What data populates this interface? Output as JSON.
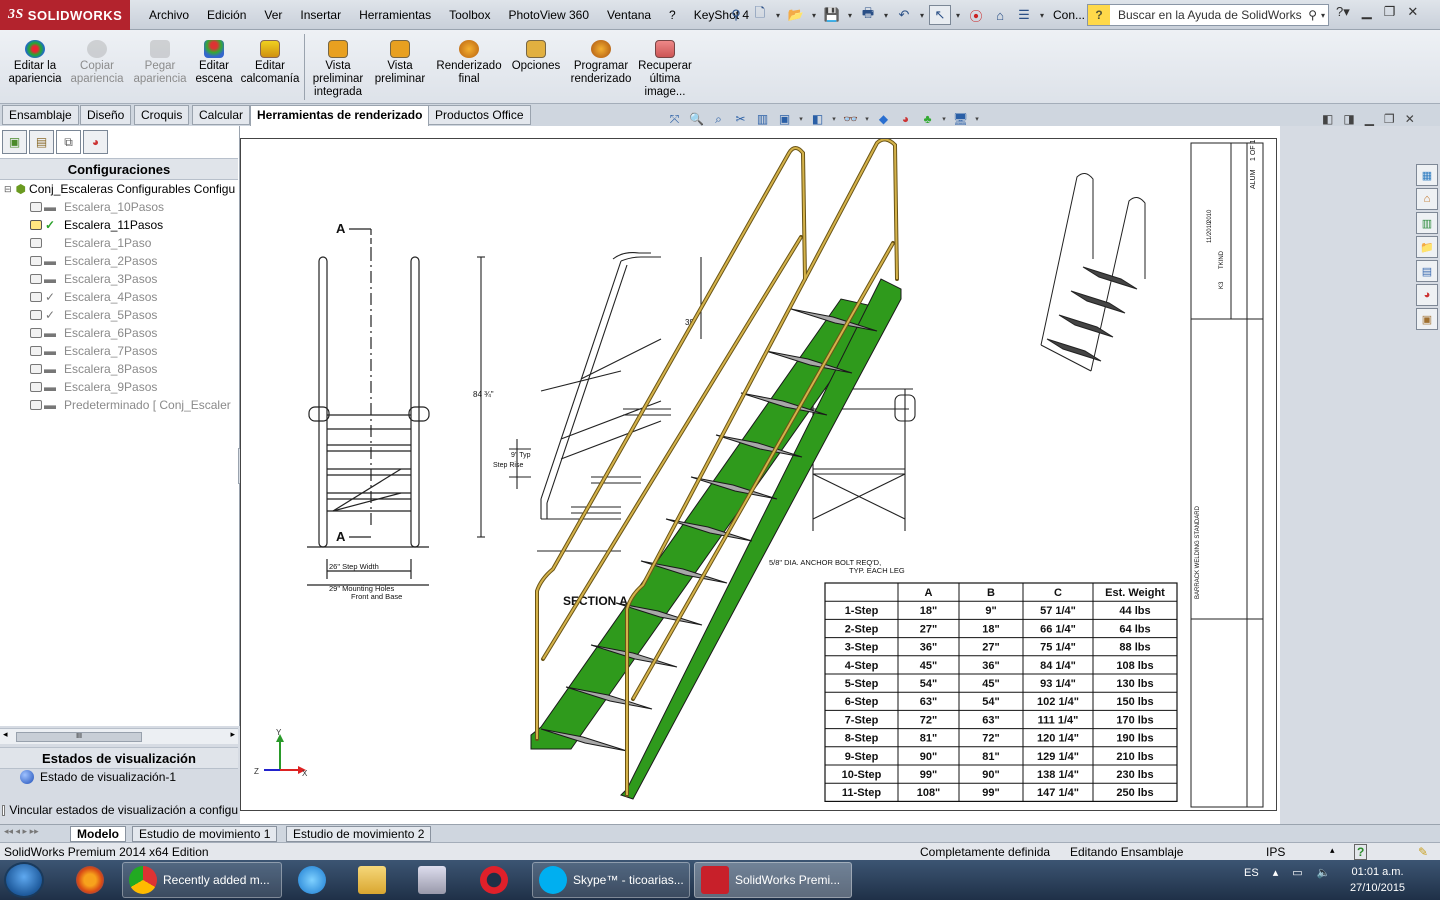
{
  "app": {
    "name": "SOLIDWORKS",
    "edition": "SolidWorks Premium 2014 x64 Edition"
  },
  "menu": [
    "Archivo",
    "Edición",
    "Ver",
    "Insertar",
    "Herramientas",
    "Toolbox",
    "PhotoView 360",
    "Ventana",
    "?",
    "KeyShot 4"
  ],
  "quick_overflow": "Con...",
  "search": {
    "placeholder": "Buscar en la Ayuda de SolidWorks"
  },
  "command_buttons": [
    {
      "label": "Editar la apariencia",
      "enabled": true
    },
    {
      "label": "Copiar apariencia",
      "enabled": false
    },
    {
      "label": "Pegar apariencia",
      "enabled": false
    },
    {
      "label": "Editar escena",
      "enabled": true
    },
    {
      "label": "Editar calcomanía",
      "enabled": true
    },
    {
      "label": "Vista preliminar integrada",
      "enabled": true
    },
    {
      "label": "Vista preliminar",
      "enabled": true
    },
    {
      "label": "Renderizado final",
      "enabled": true
    },
    {
      "label": "Opciones",
      "enabled": true
    },
    {
      "label": "Programar renderizado",
      "enabled": true
    },
    {
      "label": "Recuperar última image...",
      "enabled": true
    }
  ],
  "tabs": [
    "Ensamblaje",
    "Diseño",
    "Croquis",
    "Calcular",
    "Herramientas de renderizado",
    "Productos Office"
  ],
  "active_tab": "Herramientas de renderizado",
  "config_manager": {
    "title": "Configuraciones",
    "root": "Conj_Escaleras Configurables Configu",
    "items": [
      {
        "label": "Escalera_10Pasos",
        "mark": "dash"
      },
      {
        "label": "Escalera_11Pasos",
        "mark": "check-active"
      },
      {
        "label": "Escalera_1Paso",
        "mark": "none"
      },
      {
        "label": "Escalera_2Pasos",
        "mark": "dash"
      },
      {
        "label": "Escalera_3Pasos",
        "mark": "dash"
      },
      {
        "label": "Escalera_4Pasos",
        "mark": "check"
      },
      {
        "label": "Escalera_5Pasos",
        "mark": "check"
      },
      {
        "label": "Escalera_6Pasos",
        "mark": "dash"
      },
      {
        "label": "Escalera_7Pasos",
        "mark": "dash"
      },
      {
        "label": "Escalera_8Pasos",
        "mark": "dash"
      },
      {
        "label": "Escalera_9Pasos",
        "mark": "dash"
      },
      {
        "label": "Predeterminado [ Conj_Escaler",
        "mark": "dash"
      }
    ]
  },
  "display_states": {
    "title": "Estados de visualización",
    "item": "Estado de visualización-1",
    "link_label": "Vincular estados de visualización a configu"
  },
  "drawing": {
    "section_marker": "A",
    "dims": {
      "step_width": "26\" Step Width",
      "mounting": "29\" Mounting Holes",
      "front_base": "Front and Base",
      "height": "84 ¾\"",
      "rail": "39",
      "typ": "9\" Typ",
      "step_rise": "Step Rise",
      "bolt1": "5/8\" DIA. ANCHOR BOLT REQ'D,",
      "bolt2": "TYP. EACH LEG",
      "section": "SECTION A"
    },
    "table": {
      "headers": [
        "",
        "A",
        "B",
        "C",
        "Est. Weight"
      ],
      "rows": [
        [
          "1-Step",
          "18\"",
          "9\"",
          "57 1/4\"",
          "44 lbs"
        ],
        [
          "2-Step",
          "27\"",
          "18\"",
          "66 1/4\"",
          "64 lbs"
        ],
        [
          "3-Step",
          "36\"",
          "27\"",
          "75 1/4\"",
          "88 lbs"
        ],
        [
          "4-Step",
          "45\"",
          "36\"",
          "84 1/4\"",
          "108 lbs"
        ],
        [
          "5-Step",
          "54\"",
          "45\"",
          "93 1/4\"",
          "130 lbs"
        ],
        [
          "6-Step",
          "63\"",
          "54\"",
          "102 1/4\"",
          "150 lbs"
        ],
        [
          "7-Step",
          "72\"",
          "63\"",
          "111 1/4\"",
          "170 lbs"
        ],
        [
          "8-Step",
          "81\"",
          "72\"",
          "120 1/4\"",
          "190 lbs"
        ],
        [
          "9-Step",
          "90\"",
          "81\"",
          "129 1/4\"",
          "210 lbs"
        ],
        [
          "10-Step",
          "99\"",
          "90\"",
          "138 1/4\"",
          "230 lbs"
        ],
        [
          "11-Step",
          "108\"",
          "99\"",
          "147 1/4\"",
          "250 lbs"
        ]
      ]
    },
    "titleblock": [
      "ALUM",
      "1 OF 1",
      "TKIND",
      "K3",
      "2010",
      "11/2010",
      "BARRACK WELDING STANDARD"
    ]
  },
  "triad": {
    "y": "Y",
    "z": "Z",
    "x": "X"
  },
  "bottom_tabs": [
    "Modelo",
    "Estudio de movimiento 1",
    "Estudio de movimiento 2"
  ],
  "status": {
    "defined": "Completamente definida",
    "editing": "Editando Ensamblaje",
    "units": "IPS"
  },
  "taskbar": {
    "items": [
      "Recently added m...",
      "Skype™ - ticoarias...",
      "SolidWorks Premi..."
    ],
    "lang": "ES",
    "time": "01:01 a.m.",
    "date": "27/10/2015"
  },
  "colors": {
    "brand": "#b3232d",
    "rail": "#d4b24a",
    "stringer": "#2f9a1c",
    "tread": "#a8a8a8"
  }
}
